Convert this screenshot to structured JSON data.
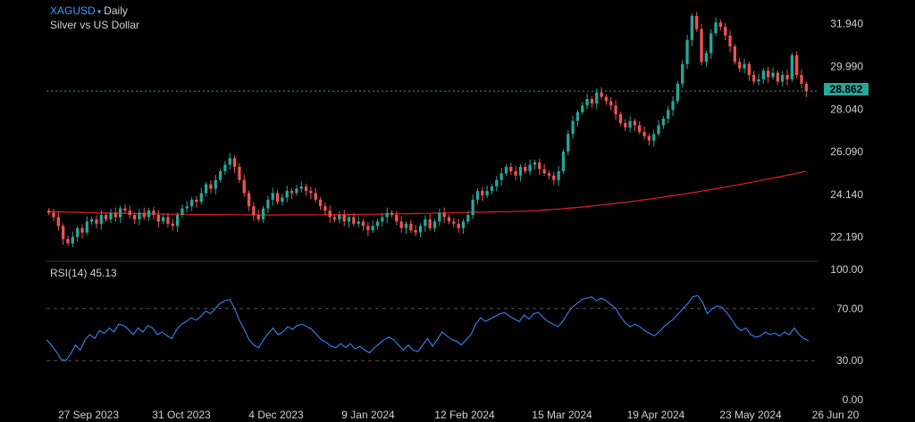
{
  "header": {
    "symbol": "XAGUSD",
    "dropdown_arrow": "▾",
    "timeframe": "Daily",
    "instrument_name": "Silver vs US Dollar",
    "current_price": "28.862"
  },
  "rsi_panel": {
    "label": "RSI(14)",
    "value": "45.13"
  },
  "colors": {
    "up": "#26a69a",
    "down": "#ef5350",
    "ma_line": "#e02020",
    "rsi_line": "#3b82f6",
    "price_line": "#26a69a",
    "symbol": "#3b9cff"
  },
  "chart_data": [
    {
      "type": "candlestick",
      "title": "XAGUSD Daily",
      "subtitle": "Silver vs US Dollar",
      "y_ticks": [
        "31.940",
        "29.990",
        "28.040",
        "26.090",
        "24.140",
        "22.190"
      ],
      "ylim": [
        21.2,
        32.7
      ],
      "x_ticks": [
        "27 Sep 2023",
        "31 Oct 2023",
        "4 Dec 2023",
        "9 Jan 2024",
        "12 Feb 2024",
        "15 Mar 2024",
        "19 Apr 2024",
        "23 May 2024",
        "26 Jun 20"
      ],
      "current_price": 28.862,
      "close_series": [
        23.3,
        23.1,
        22.7,
        22.1,
        21.9,
        22.2,
        22.6,
        22.4,
        22.9,
        23.0,
        22.8,
        23.2,
        23.0,
        23.3,
        23.1,
        23.5,
        23.4,
        23.2,
        23.0,
        23.3,
        23.1,
        23.4,
        23.2,
        22.9,
        23.1,
        22.8,
        22.7,
        23.2,
        23.5,
        23.6,
        23.9,
        23.8,
        24.2,
        24.6,
        24.4,
        24.8,
        25.2,
        25.5,
        25.8,
        25.4,
        24.8,
        24.2,
        23.6,
        23.2,
        23.0,
        23.5,
        23.9,
        24.2,
        23.8,
        24.0,
        24.3,
        24.2,
        24.4,
        24.5,
        24.3,
        24.2,
        23.9,
        23.6,
        23.4,
        23.1,
        23.0,
        23.2,
        22.9,
        23.1,
        22.8,
        22.9,
        22.7,
        22.5,
        22.7,
        22.9,
        23.1,
        23.3,
        23.2,
        22.9,
        22.6,
        22.8,
        22.5,
        22.4,
        22.7,
        23.0,
        22.6,
        22.9,
        23.3,
        23.1,
        22.9,
        22.8,
        22.6,
        22.9,
        23.2,
        23.9,
        24.3,
        24.1,
        24.3,
        24.5,
        24.8,
        25.1,
        25.4,
        25.2,
        25.0,
        25.4,
        25.2,
        25.5,
        25.6,
        25.3,
        25.1,
        25.0,
        24.8,
        25.2,
        26.1,
        26.9,
        27.5,
        27.9,
        28.2,
        28.5,
        28.3,
        28.8,
        28.6,
        28.4,
        28.2,
        27.8,
        27.4,
        27.2,
        27.5,
        27.3,
        27.0,
        26.8,
        26.6,
        26.9,
        27.3,
        27.6,
        28.0,
        28.4,
        29.2,
        30.1,
        31.2,
        32.3,
        31.7,
        30.2,
        30.6,
        31.5,
        32.0,
        31.8,
        31.4,
        30.9,
        30.2,
        29.9,
        30.1,
        29.6,
        29.3,
        29.4,
        29.8,
        29.5,
        29.7,
        29.3,
        29.6,
        29.4,
        30.5,
        29.6,
        29.2,
        28.86
      ],
      "moving_average": {
        "start": 23.35,
        "low": 23.1,
        "end": 25.2
      }
    },
    {
      "type": "line",
      "title": "RSI(14)",
      "value_label": "45.13",
      "y_ticks": [
        "100.00",
        "70.00",
        "30.00",
        "0.00"
      ],
      "ylim": [
        0,
        100
      ],
      "reference_lines": [
        70,
        30
      ],
      "series": [
        {
          "values": [
            46,
            42,
            37,
            31,
            30,
            35,
            42,
            38,
            46,
            50,
            47,
            53,
            51,
            55,
            52,
            58,
            57,
            54,
            50,
            55,
            52,
            57,
            55,
            50,
            52,
            49,
            47,
            54,
            58,
            60,
            63,
            61,
            64,
            68,
            66,
            70,
            74,
            76,
            77,
            70,
            61,
            54,
            46,
            42,
            40,
            46,
            51,
            55,
            50,
            52,
            56,
            54,
            57,
            58,
            56,
            54,
            50,
            46,
            44,
            41,
            40,
            43,
            40,
            43,
            39,
            41,
            38,
            36,
            40,
            43,
            46,
            48,
            46,
            42,
            38,
            42,
            38,
            37,
            42,
            47,
            41,
            46,
            52,
            49,
            46,
            45,
            42,
            46,
            50,
            58,
            63,
            60,
            62,
            64,
            66,
            67,
            64,
            62,
            60,
            65,
            62,
            66,
            67,
            63,
            60,
            58,
            56,
            60,
            66,
            71,
            74,
            77,
            78,
            79,
            76,
            78,
            76,
            73,
            70,
            64,
            59,
            56,
            58,
            56,
            53,
            51,
            49,
            52,
            56,
            59,
            62,
            66,
            70,
            74,
            79,
            80,
            75,
            66,
            70,
            72,
            71,
            67,
            62,
            56,
            53,
            55,
            50,
            48,
            49,
            52,
            50,
            51,
            49,
            52,
            50,
            55,
            50,
            47,
            45.13
          ]
        }
      ]
    }
  ]
}
